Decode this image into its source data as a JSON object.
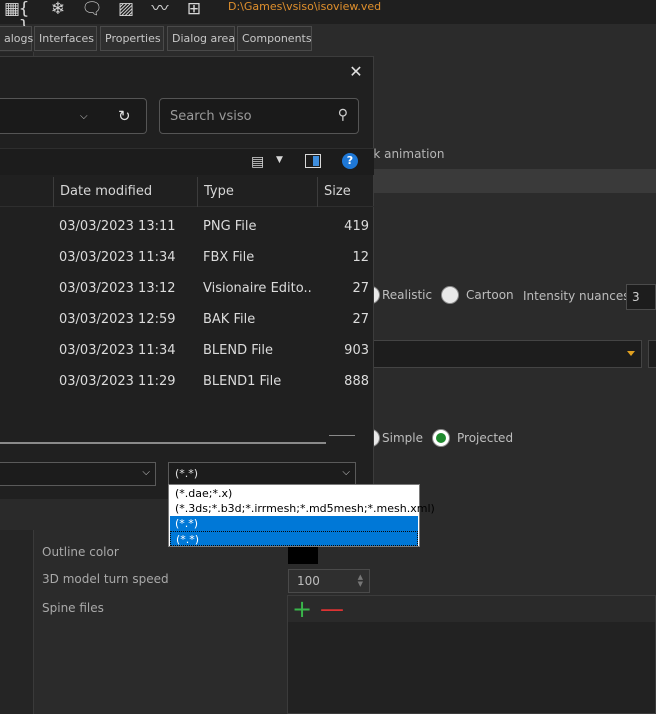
{
  "toolbar": {
    "path": "D:\\Games\\vsiso\\isoview.ved",
    "icons": [
      "braces-icon",
      "snowflake-icon",
      "message-icon",
      "hatch-icon",
      "waveform-icon",
      "node-tree-icon"
    ]
  },
  "tabs": [
    "alogs",
    "Interfaces",
    "Properties",
    "Dialog area",
    "Components"
  ],
  "editor": {
    "walk_animation": "lk animation",
    "render_modes": [
      "Realistic",
      "Cartoon"
    ],
    "render_mode_selected": null,
    "intensity_label": "Intensity nuances",
    "intensity_value": "3",
    "projection_modes": [
      "Simple",
      "Projected"
    ],
    "projection_selected": "Projected",
    "outline_color_label": "Outline color",
    "outline_color": "#000000",
    "turn_speed_label": "3D model turn speed",
    "turn_speed_value": "100",
    "spine_files_label": "Spine files",
    "spine_add": "+",
    "spine_remove": "—"
  },
  "dialog": {
    "close": "✕",
    "search_placeholder": "Search vsiso",
    "help": "?",
    "columns": [
      "Date modified",
      "Type",
      "Size"
    ],
    "files": [
      {
        "date": "03/03/2023 13:11",
        "type": "PNG File",
        "size": "419"
      },
      {
        "date": "03/03/2023 11:34",
        "type": "FBX File",
        "size": "12"
      },
      {
        "date": "03/03/2023 13:12",
        "type": "Visionaire Edito...",
        "size": "27"
      },
      {
        "date": "03/03/2023 12:59",
        "type": "BAK File",
        "size": "27"
      },
      {
        "date": "03/03/2023 11:34",
        "type": "BLEND File",
        "size": "903"
      },
      {
        "date": "03/03/2023 11:29",
        "type": "BLEND1 File",
        "size": "888"
      }
    ],
    "filter_value": "(*.*)",
    "filter_options": [
      "(*.dae;*.x)",
      "(*.3ds;*.b3d;*.irrmesh;*.md5mesh;*.mesh.xml)",
      "(*.*)",
      "(*.*)"
    ]
  }
}
